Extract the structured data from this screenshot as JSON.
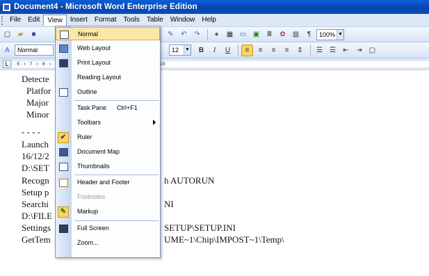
{
  "window": {
    "title": "Document4 - Microsoft Word Enterprise Edition",
    "icon": "word-app-icon"
  },
  "menubar": {
    "items": [
      "File",
      "Edit",
      "View",
      "Insert",
      "Format",
      "Tools",
      "Table",
      "Window",
      "Help"
    ],
    "open_item": "View"
  },
  "toolbar": {
    "zoom_value": "100%",
    "style_value": "Normal",
    "font_size_value": "12"
  },
  "ruler": {
    "scale_text": "· 6 · ı · 7 · ı · 8 · ı · 9 · ı · 10 · ı · 11 · ı · 12 · ı · 13 · ı · 14 · ı · 15 · ı · 16"
  },
  "view_menu": {
    "items": [
      {
        "label": "Normal",
        "icon": "normal-view-icon",
        "state": "highlighted"
      },
      {
        "label": "Web Layout",
        "icon": "web-layout-icon"
      },
      {
        "label": "Print Layout",
        "icon": "print-layout-icon"
      },
      {
        "label": "Reading Layout",
        "icon": "reading-layout-icon"
      },
      {
        "label": "Outline",
        "icon": "outline-view-icon"
      },
      {
        "label": "Task Pane",
        "shortcut": "Ctrl+F1"
      },
      {
        "label": "Toolbars",
        "submenu": true
      },
      {
        "label": "Ruler",
        "icon": "check-icon",
        "state": "checked"
      },
      {
        "label": "Document Map",
        "icon": "document-map-icon"
      },
      {
        "label": "Thumbnails",
        "icon": "thumbnails-icon"
      },
      {
        "label": "Header and Footer",
        "icon": "header-footer-icon"
      },
      {
        "label": "Footnotes",
        "state": "disabled"
      },
      {
        "label": "Markup",
        "icon": "markup-icon"
      },
      {
        "label": "Full Screen",
        "icon": "full-screen-icon"
      },
      {
        "label": "Zoom..."
      }
    ]
  },
  "document": {
    "lines": [
      "Detecte",
      "Platfor",
      "Major",
      "Minor",
      "- - - -",
      "Launch",
      "16/12/2",
      "D:\\SET",
      "Recogn",
      "Setup p",
      "Searchi",
      "D:\\FILE",
      "Settings",
      "GetTem"
    ],
    "fragments": [
      "h AUTORUN",
      "NI",
      "SETUP\\SETUP.INI",
      "UME~1\\Chip\\IMPOST~1\\Temp\\"
    ]
  },
  "colors": {
    "titlebar": "#0a4fbf",
    "menubar": "#dde8f7",
    "highlight": "#fbe7a8"
  }
}
